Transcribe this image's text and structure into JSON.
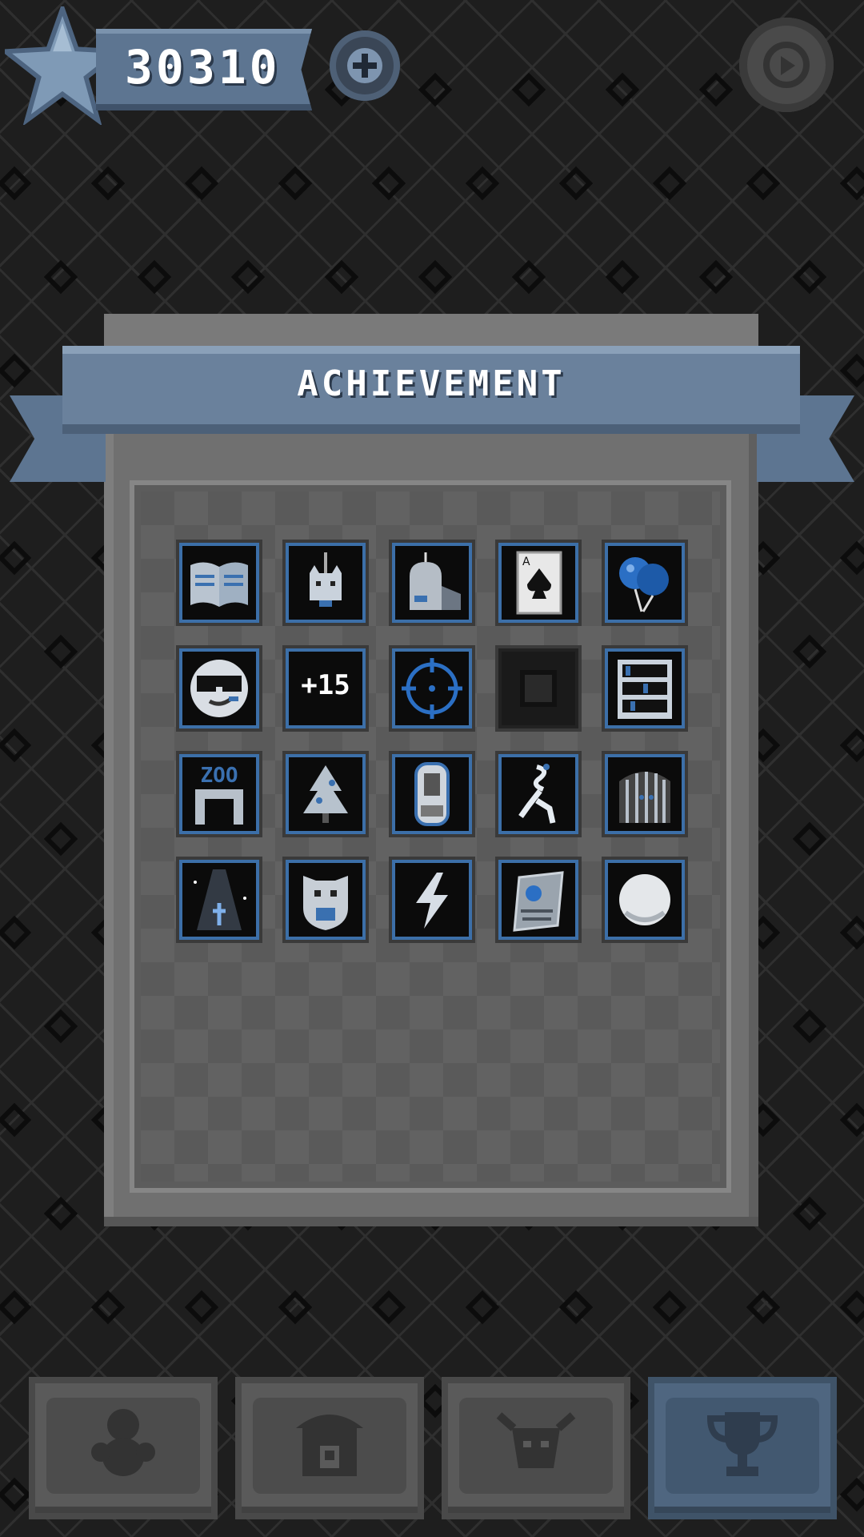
{
  "header": {
    "score": "30310",
    "star_icon": "star-icon",
    "add_icon": "plus-icon",
    "pause_icon": "pause-icon"
  },
  "panel": {
    "title": "ACHIEVEMENT"
  },
  "achievements": [
    {
      "icon": "open-book-icon",
      "locked": false
    },
    {
      "icon": "hanging-cat-icon",
      "locked": false
    },
    {
      "icon": "tombstone-icon",
      "locked": false
    },
    {
      "icon": "ace-of-spades-icon",
      "locked": false
    },
    {
      "icon": "balloon-icon",
      "locked": false
    },
    {
      "icon": "cool-face-icon",
      "locked": false
    },
    {
      "icon": "plus-fifteen-icon",
      "text": "+15",
      "locked": false
    },
    {
      "icon": "crosshair-icon",
      "locked": false
    },
    {
      "icon": "locked-square-icon",
      "locked": true
    },
    {
      "icon": "bookshelf-icon",
      "locked": false
    },
    {
      "icon": "zoo-gate-icon",
      "text": "ZOO",
      "locked": false
    },
    {
      "icon": "christmas-tree-icon",
      "locked": false
    },
    {
      "icon": "capsule-icon",
      "locked": false
    },
    {
      "icon": "runner-icon",
      "locked": false
    },
    {
      "icon": "cage-icon",
      "locked": false
    },
    {
      "icon": "light-beam-icon",
      "locked": false
    },
    {
      "icon": "shield-cat-icon",
      "locked": false
    },
    {
      "icon": "lightning-icon",
      "locked": false
    },
    {
      "icon": "map-scroll-icon",
      "locked": false
    },
    {
      "icon": "white-orb-icon",
      "locked": false
    }
  ],
  "tabs": [
    {
      "icon": "character-icon",
      "active": false
    },
    {
      "icon": "shop-icon",
      "active": false
    },
    {
      "icon": "bull-head-icon",
      "active": false
    },
    {
      "icon": "trophy-icon",
      "active": true
    }
  ],
  "colors": {
    "background": "#1e1e1e",
    "ribbon": "#6a819c",
    "panel": "#707070",
    "tile_border": "#3c6fa8",
    "active_tab": "#4f6680"
  }
}
